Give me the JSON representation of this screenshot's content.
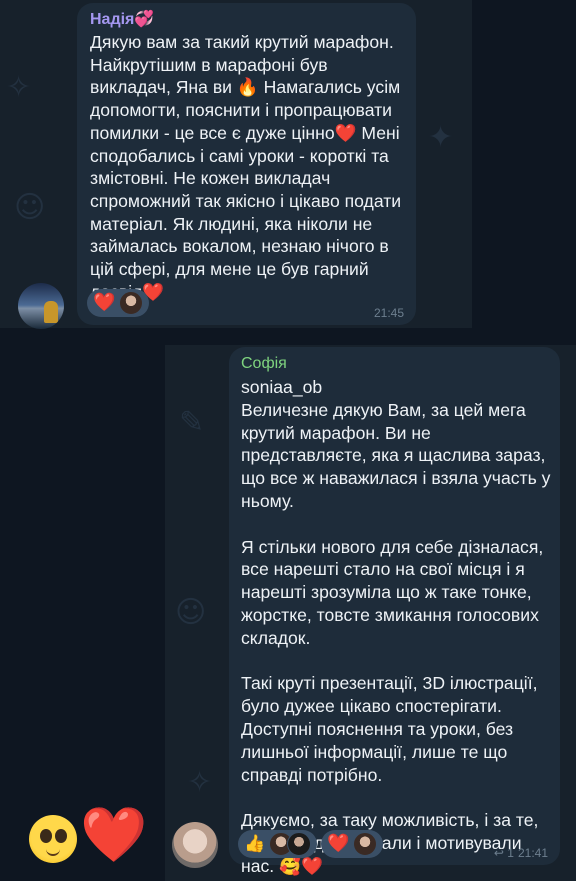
{
  "messages": [
    {
      "sender": "Надія💞",
      "text": "Дякую вам за такий крутий марафон. Найкрутішим в марафоні був викладач, Яна ви 🔥 Намагались усім допомогти, пояснити і пропрацювати помилки - це все є дуже цінно❤️ Мені сподобались і самі уроки - короткі та змістовні. Не кожен викладач спроможний так якісно і цікаво подати матеріал. Як людині, яка ніколи не займалась вокалом, незнаю нічого в цій сфері, для мене це був гарний досвід❤️",
      "time": "21:45",
      "reaction_emoji": "❤️"
    },
    {
      "sender": "Софія",
      "text": "soniaa_ob\nВеличезне дякую Вам, за цей мега крутий марафон. Ви не представляєте, яка я щаслива зараз, що все ж наважилася і взяла участь у ньому.\n\nЯ стільки нового для себе дізналася, все нарешті стало на свої місця і я нарешті зрозуміла що ж таке тонке, жорстке, товсте змикання голосових складок.\n\nТакі круті презентації, 3D ілюстрації, було дужее цікаво спостерігати. Доступні пояснення та уроки, без лишньої інформації, лише те що справді потрібно.\n\nДякуємо, за таку можливість, і за те, що так підтримували і мотивували нас. 🥰❤️",
      "time": "21:41",
      "replies": "↩ 1",
      "reaction_emoji_1": "👍",
      "reaction_emoji_2": "❤️"
    }
  ],
  "footer": {
    "emoji_1": "🥹",
    "emoji_2": "❤️"
  }
}
